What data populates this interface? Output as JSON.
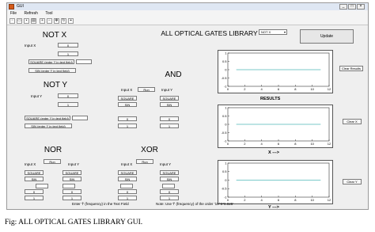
{
  "window": {
    "title": "GUI",
    "menu": [
      "File",
      "Refresh",
      "Tool"
    ],
    "toolbar_icons": [
      "new-file-icon",
      "open-folder-icon",
      "save-icon",
      "print-icon",
      "zoom-in-icon",
      "zoom-out-icon",
      "pan-icon",
      "rotate-icon",
      "data-cursor-icon"
    ]
  },
  "main_title": "ALL OPTICAL GATES LIBRARY",
  "selector": {
    "value": "NOT X"
  },
  "update_button": "Update",
  "not_x": {
    "title": "NOT X",
    "input_x": "Input X",
    "btn_0": "0",
    "btn_1": "1",
    "square_btn": "SQUARE (enter 'f' in text field)",
    "sin_btn": "SIN (enter 'f' in text field)"
  },
  "not_y": {
    "title": "NOT Y",
    "input_y": "Input Y",
    "btn_0": "0",
    "btn_1": "1",
    "square_btn": "SQUARE (enter 'f' in text field)",
    "sin_btn": "SIN (enter 'f' in text field)"
  },
  "and": {
    "title": "AND",
    "input_x": "Input X",
    "run": "Run",
    "input_y": "Input Y",
    "square": "SQUARE",
    "sin": "SIN",
    "btn_0": "0",
    "btn_1": "1"
  },
  "nor": {
    "title": "NOR",
    "input_x": "Input X",
    "run": "Run",
    "input_y": "Input Y",
    "square": "SQUARE",
    "sin": "SIN",
    "btn_0": "0",
    "btn_1": "1"
  },
  "xor": {
    "title": "XOR",
    "input_x": "Input X",
    "run": "Run",
    "input_y": "Input Y",
    "square": "SQUARE",
    "sin": "SIN",
    "btn_0": "0",
    "btn_1": "1"
  },
  "plots": {
    "results_label": "RESULTS",
    "x_label": "X --->",
    "y_label": "Y --->",
    "clear_results": "Clear Results",
    "clear_x": "Clear X",
    "clear_y": "Clear Y",
    "line_color": "#4fb8b8"
  },
  "chart_data": [
    {
      "type": "line",
      "title": "",
      "xlabel": "",
      "ylabel": "",
      "xlim": [
        0,
        12
      ],
      "ylim": [
        -1,
        1
      ],
      "xticks": [
        0,
        2,
        4,
        6,
        8,
        10,
        12
      ],
      "yticks": [
        1,
        0.5,
        0,
        -0.5,
        -1
      ],
      "series": [
        {
          "x": [
            1,
            11
          ],
          "y": [
            0,
            0
          ]
        }
      ]
    },
    {
      "type": "line",
      "title": "",
      "xlabel": "",
      "ylabel": "",
      "xlim": [
        0,
        12
      ],
      "ylim": [
        -1,
        1
      ],
      "xticks": [
        0,
        2,
        4,
        6,
        8,
        10,
        12
      ],
      "yticks": [
        1,
        0.5,
        0,
        -0.5,
        -1
      ],
      "series": [
        {
          "x": [
            1,
            11
          ],
          "y": [
            0,
            0
          ]
        }
      ]
    },
    {
      "type": "line",
      "title": "",
      "xlabel": "",
      "ylabel": "",
      "xlim": [
        0,
        12
      ],
      "ylim": [
        -1,
        1
      ],
      "xticks": [
        0,
        2,
        4,
        6,
        8,
        10,
        12
      ],
      "yticks": [
        1,
        0.5,
        0,
        -0.5,
        -1
      ],
      "series": [
        {
          "x": [
            1,
            11
          ],
          "y": [
            0,
            0
          ]
        }
      ]
    }
  ],
  "footnotes": {
    "left": "Enter 'f' (frequency) in the Text Field",
    "right": "Note: Use 'f' (frequency) of the order '10^0*0.025'"
  },
  "caption": "Fig: ALL OPTICAL GATES LIBRARY GUI."
}
